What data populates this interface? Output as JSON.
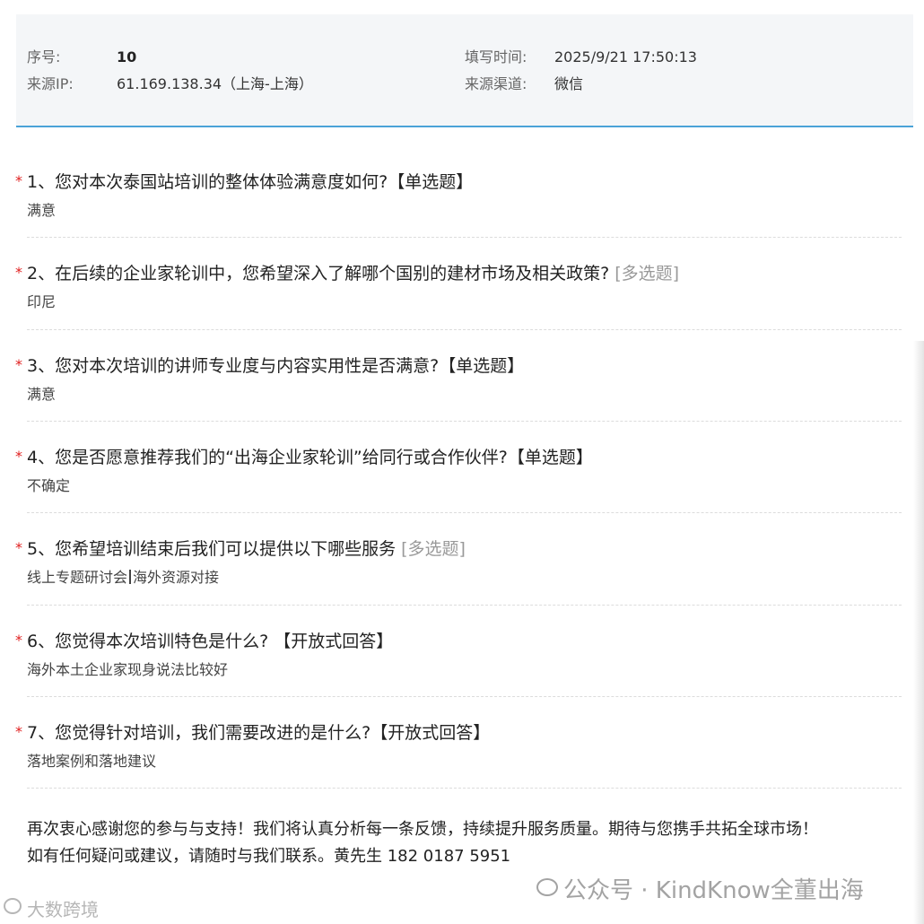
{
  "meta": {
    "seq_label": "序号:",
    "seq_value": "10",
    "ip_label": "来源IP:",
    "ip_value": "61.169.138.34（上海-上海）",
    "time_label": "填写时间:",
    "time_value": "2025/9/21 17:50:13",
    "channel_label": "来源渠道:",
    "channel_value": "微信"
  },
  "questions": [
    {
      "star": "*",
      "title": "1、您对本次泰国站培训的整体体验满意度如何?",
      "type": "【单选题】",
      "answer": "满意"
    },
    {
      "star": "*",
      "title": "2、在后续的企业家轮训中，您希望深入了解哪个国别的建材市场及相关政策?",
      "type": "[多选题]",
      "answer": "印尼"
    },
    {
      "star": "*",
      "title": "3、您对本次培训的讲师专业度与内容实用性是否满意?",
      "type": "【单选题】",
      "answer": "满意"
    },
    {
      "star": "*",
      "title": "4、您是否愿意推荐我们的“出海企业家轮训”给同行或合作伙伴?",
      "type": "【单选题】",
      "answer": "不确定"
    },
    {
      "star": "*",
      "title": "5、您希望培训结束后我们可以提供以下哪些服务",
      "type": "[多选题]",
      "answer_a": "线上专题研讨会",
      "answer_b": "海外资源对接"
    },
    {
      "star": "*",
      "title": "6、您觉得本次培训特色是什么? ",
      "type": "【开放式回答】",
      "answer": "海外本土企业家现身说法比较好"
    },
    {
      "star": "*",
      "title": "7、您觉得针对培训，我们需要改进的是什么?",
      "type": "【开放式回答】",
      "answer": "落地案例和落地建议"
    }
  ],
  "closing": {
    "line1": "再次衷心感谢您的参与与支持！我们将认真分析每一条反馈，持续提升服务质量。期待与您携手共拓全球市场！",
    "line2": "如有任何疑问或建议，请随时与我们联系。黄先生 182 0187 5951"
  },
  "watermark": {
    "text": "公众号 · KindKnow全董出海",
    "text2": "大数跨境"
  },
  "colors": {
    "accent": "#4aa3d8",
    "required": "#e02020",
    "panel_bg": "#f4f6f8"
  }
}
